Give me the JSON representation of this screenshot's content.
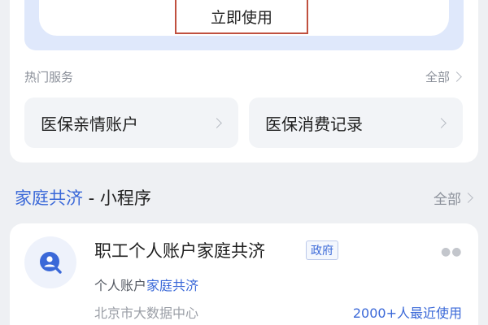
{
  "banner": {
    "use_button": "立即使用"
  },
  "hot_services": {
    "label": "热门服务",
    "all": "全部",
    "items": [
      {
        "label": "医保亲情账户"
      },
      {
        "label": "医保消费记录"
      }
    ]
  },
  "mini_programs": {
    "title_highlight": "家庭共济",
    "title_rest": " - 小程序",
    "all": "全部",
    "item": {
      "name": "职工个人账户家庭共济",
      "badge": "政府",
      "sub_prefix": "个人账户",
      "sub_highlight": "家庭共济",
      "org": "北京市大数据中心",
      "users": "2000+人最近使用",
      "icon": "search-person-icon",
      "more_icon": "more-dots-icon"
    }
  },
  "colors": {
    "accent": "#3a68d8",
    "highlight_border": "#c0503f",
    "banner_bg": "#dfe8fb"
  }
}
